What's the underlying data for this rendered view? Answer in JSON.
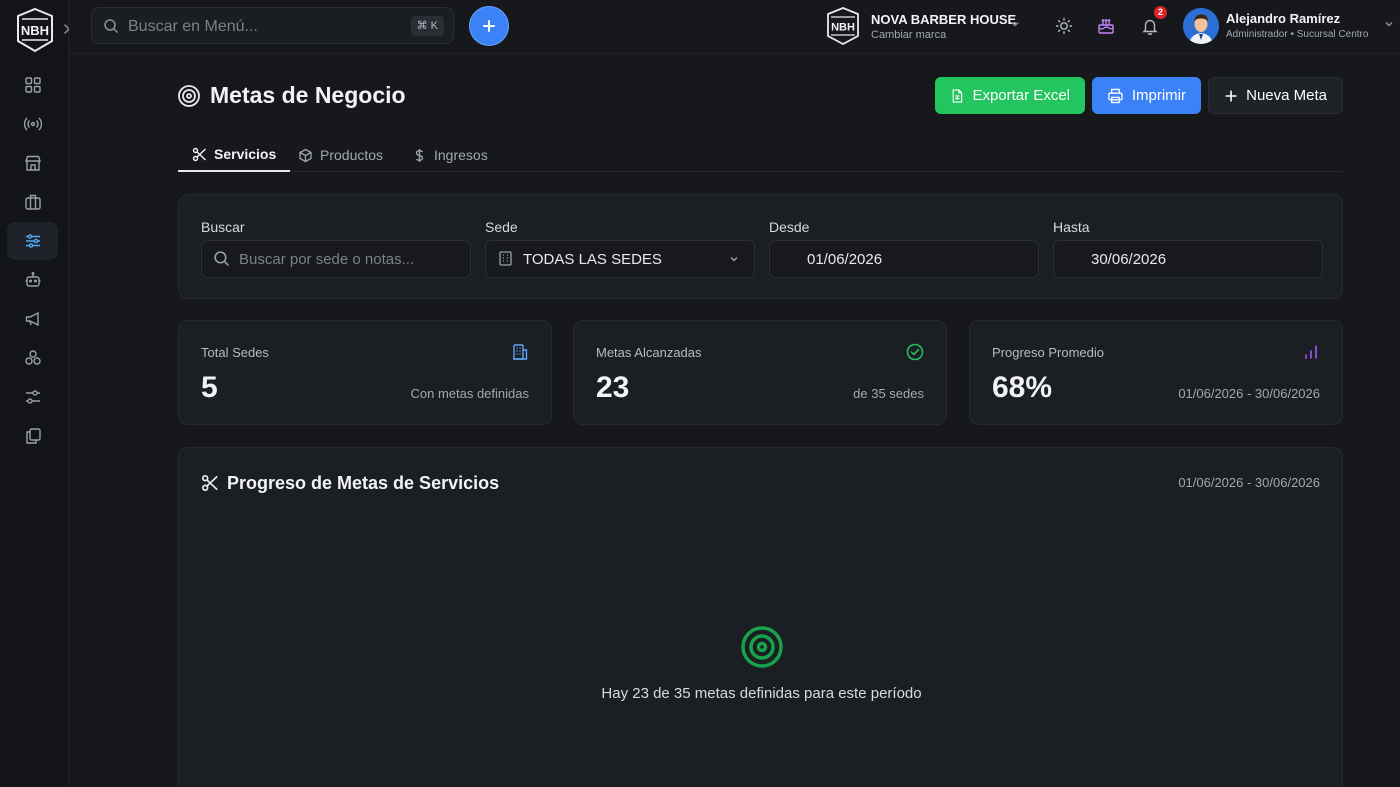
{
  "sidebar": {
    "logo_text": "NBH",
    "items": [
      {
        "icon": "dashboard-icon"
      },
      {
        "icon": "broadcast-icon"
      },
      {
        "icon": "store-icon"
      },
      {
        "icon": "briefcase-icon"
      },
      {
        "icon": "sliders-icon",
        "active": true
      },
      {
        "icon": "robot-icon"
      },
      {
        "icon": "megaphone-icon"
      },
      {
        "icon": "network-icon"
      },
      {
        "icon": "settings-sliders-icon"
      },
      {
        "icon": "copy-icon"
      }
    ]
  },
  "topbar": {
    "search_placeholder": "Buscar en Menú...",
    "shortcut": "⌘ K",
    "brand_logo_text": "NBH",
    "brand_name": "NOVA BARBER HOUSE",
    "brand_sub": "Cambiar marca",
    "notifications_count": "2",
    "user_name": "Alejandro Ramírez",
    "user_role": "Administrador • Sucursal Centro"
  },
  "page": {
    "title": "Metas de Negocio",
    "actions": {
      "export": "Exportar Excel",
      "print": "Imprimir",
      "new": "Nueva Meta"
    },
    "tabs": [
      {
        "label": "Servicios",
        "active": true
      },
      {
        "label": "Productos"
      },
      {
        "label": "Ingresos"
      }
    ]
  },
  "filters": {
    "search_label": "Buscar",
    "search_placeholder": "Buscar por sede o notas...",
    "sede_label": "Sede",
    "sede_value": "TODAS LAS SEDES",
    "from_label": "Desde",
    "from_value": "01/06/2026",
    "to_label": "Hasta",
    "to_value": "30/06/2026"
  },
  "stats": [
    {
      "label": "Total Sedes",
      "value": "5",
      "note": "Con metas definidas",
      "icon": "building-icon"
    },
    {
      "label": "Metas Alcanzadas",
      "value": "23",
      "note": "de 35 sedes",
      "icon": "check-circle-icon"
    },
    {
      "label": "Progreso Promedio",
      "value": "68%",
      "note": "01/06/2026 - 30/06/2026",
      "icon": "bar-chart-icon"
    }
  ],
  "progress": {
    "title": "Progreso de Metas de Servicios",
    "range": "01/06/2026 - 30/06/2026",
    "message": "Hay 23 de 35 metas definidas para este período"
  },
  "colors": {
    "accent_blue": "#3b82f6",
    "accent_green": "#22c55e",
    "target_green": "#16a34a",
    "purple": "#a855f7",
    "badge_red": "#dc2626"
  }
}
